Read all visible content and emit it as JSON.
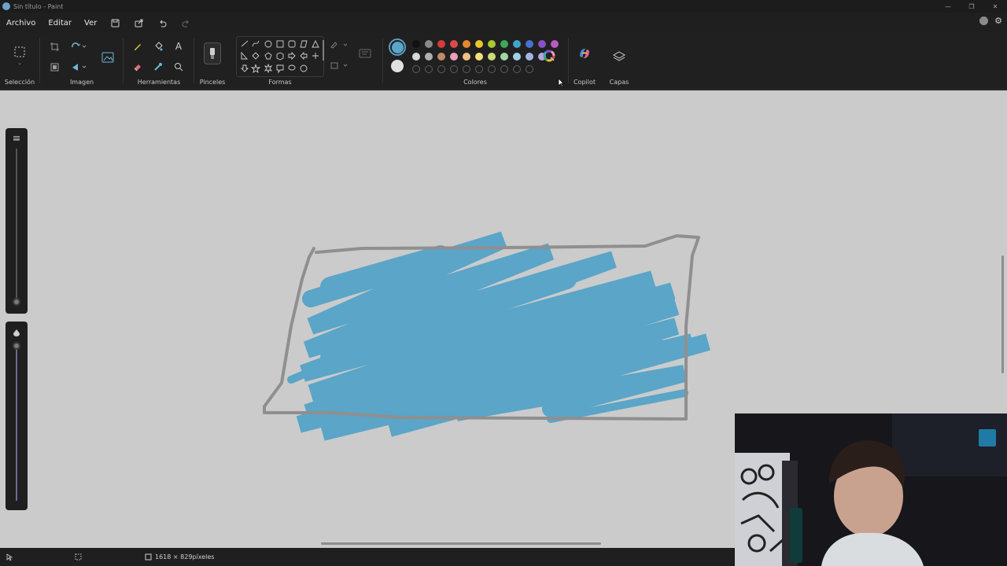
{
  "window": {
    "title": "Sin título - Paint"
  },
  "menu": {
    "file": "Archivo",
    "edit": "Editar",
    "view": "Ver"
  },
  "ribbon": {
    "selection_label": "Selección",
    "image_label": "Imagen",
    "tools_label": "Herramientas",
    "brushes_label": "Pinceles",
    "shapes_label": "Formas",
    "colors_label": "Colores",
    "copilot_label": "Copilot",
    "layers_label": "Capas"
  },
  "colors": {
    "primary": "#5aa5c8",
    "secondary": "#e0e0e0",
    "row1": [
      "#111111",
      "#8a8a8a",
      "#d63a3a",
      "#e04848",
      "#e8862e",
      "#e8c62e",
      "#a9c92f",
      "#3fa857",
      "#3fa3c8",
      "#4a6fd1",
      "#8a4fc7",
      "#b65cc2"
    ],
    "row2": [
      "#d9d9d9",
      "#b0b0b0",
      "#c08a6a",
      "#e9a0b8",
      "#f0c080",
      "#f2e07a",
      "#c8dc78",
      "#9fd6a6",
      "#9fd0e6",
      "#a0b4e6",
      "#b9a2df"
    ]
  },
  "canvas": {
    "stroke_color": "#8f8f8f",
    "fill_color": "#5aa5c8",
    "background": "#cbcbcb"
  },
  "status": {
    "dimensions": "1618 × 829píxeles"
  }
}
